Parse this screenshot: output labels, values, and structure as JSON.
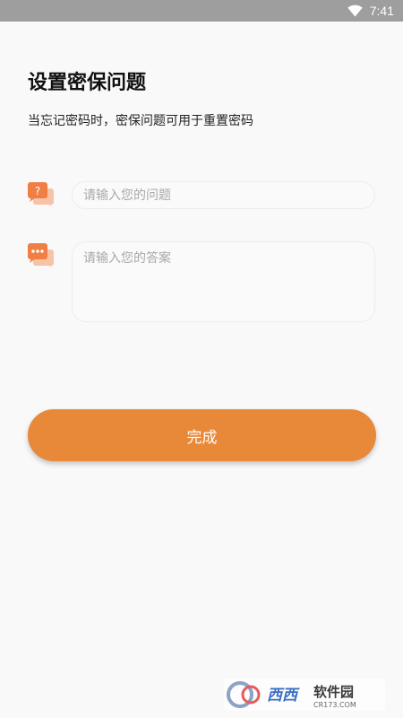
{
  "status_bar": {
    "time": "7:41",
    "wifi_icon": "wifi-icon",
    "background_color": "#9e9e9e"
  },
  "header": {
    "title": "设置密保问题",
    "subtitle": "当忘记密码时，密保问题可用于重置密码"
  },
  "form": {
    "question": {
      "icon": "question-chat-icon",
      "placeholder": "请输入您的问题",
      "value": ""
    },
    "answer": {
      "icon": "chat-dots-icon",
      "placeholder": "请输入您的答案",
      "value": ""
    }
  },
  "actions": {
    "done_label": "完成",
    "accent_color": "#e8893a"
  },
  "watermark": {
    "text": "西西软件园",
    "url_text": "CR173.COM"
  }
}
